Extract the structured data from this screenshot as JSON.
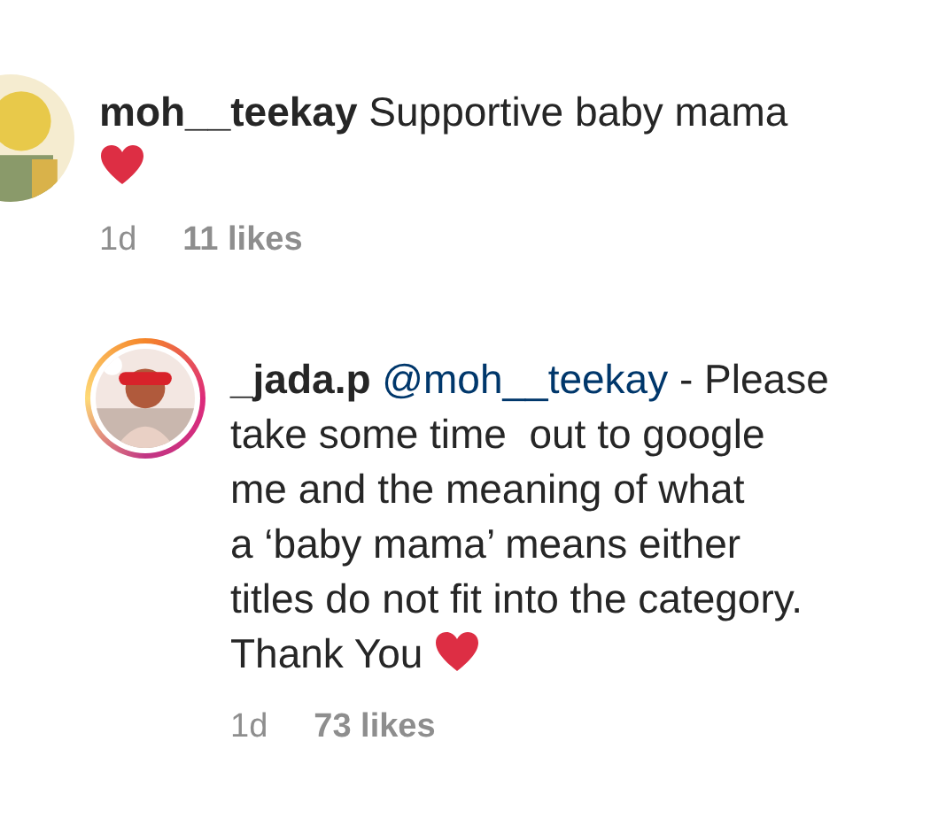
{
  "comments": [
    {
      "username": "moh__teekay",
      "text": "Supportive baby mama",
      "story_ring": false,
      "time": "1d",
      "likes": "11 likes",
      "reply": false
    },
    {
      "username": "_jada.p",
      "mention": "@moh__teekay",
      "text": " - Please\ntake some time  out to google\nme and the meaning of what\na ‘baby mama’ means either\ntitles do not fit into the category.\nThank You",
      "story_ring": true,
      "time": "1d",
      "likes": "73 likes",
      "reply": true
    }
  ]
}
